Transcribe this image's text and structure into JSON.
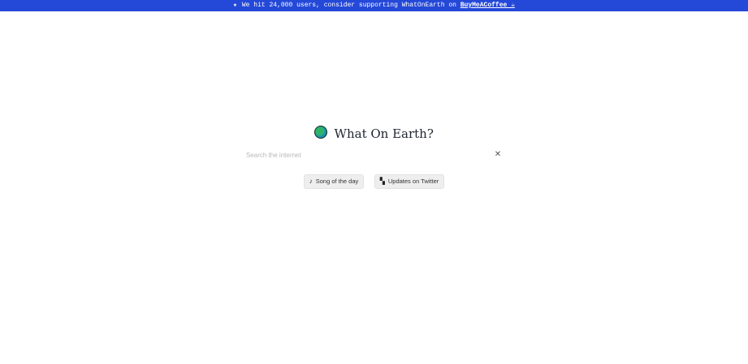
{
  "banner": {
    "star_icon": "star-icon",
    "text": "We hit 24,000 users, consider supporting WhatOnEarth on ",
    "link_label": "BuyMeACoffee ☕",
    "background": "#2448d8"
  },
  "header": {
    "logo_icon": "globe-icon",
    "title": "What On Earth?"
  },
  "search": {
    "placeholder": "Search the internet",
    "value": "",
    "clear_icon": "close-icon"
  },
  "buttons": {
    "song_label": "Song of the day",
    "song_icon": "music-note-icon",
    "updates_label": "Updates on Twitter",
    "updates_icon": "bird-icon"
  }
}
